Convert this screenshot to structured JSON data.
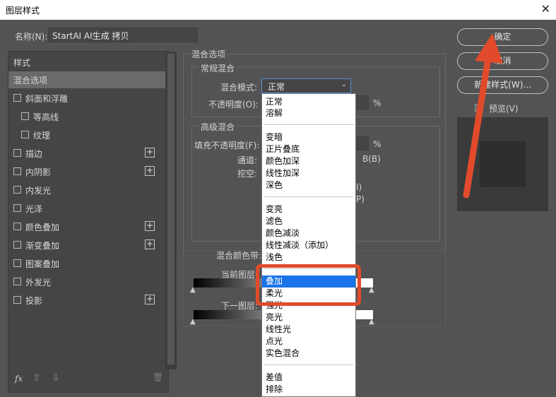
{
  "window": {
    "title": "图层样式",
    "close_glyph": "✕"
  },
  "name_row": {
    "label": "名称(N):",
    "value": "StartAI AI生成 拷贝"
  },
  "left_panel": {
    "header": "样式",
    "items": [
      {
        "label": "混合选项",
        "checkbox": false,
        "plus": false,
        "selected": true
      },
      {
        "label": "斜面和浮雕",
        "checkbox": true,
        "plus": false
      },
      {
        "label": "等高线",
        "checkbox": true,
        "plus": false,
        "indent": true
      },
      {
        "label": "纹理",
        "checkbox": true,
        "plus": false,
        "indent": true
      },
      {
        "label": "描边",
        "checkbox": true,
        "plus": true
      },
      {
        "label": "内阴影",
        "checkbox": true,
        "plus": true
      },
      {
        "label": "内发光",
        "checkbox": true,
        "plus": false
      },
      {
        "label": "光泽",
        "checkbox": true,
        "plus": false
      },
      {
        "label": "颜色叠加",
        "checkbox": true,
        "plus": true
      },
      {
        "label": "渐变叠加",
        "checkbox": true,
        "plus": true
      },
      {
        "label": "图案叠加",
        "checkbox": true,
        "plus": false
      },
      {
        "label": "外发光",
        "checkbox": true,
        "plus": false
      },
      {
        "label": "投影",
        "checkbox": true,
        "plus": true
      }
    ],
    "plus_glyph": "+",
    "bottom": {
      "fx": "fx",
      "up": "⇧",
      "down": "⇩",
      "trash": "🗑"
    }
  },
  "blend": {
    "section_title": "混合选项",
    "general_title": "常规混合",
    "mode_label": "混合模式:",
    "mode_value": "正常",
    "chevron": "⌄",
    "opacity_label": "不透明度(O):",
    "opacity_unit": "%",
    "advanced_title": "高级混合",
    "fill_label": "填充不透明度(F):",
    "fill_unit": "%",
    "channel_label": "通道:",
    "channel_b": "B(B)",
    "knockout_label": "挖空:",
    "right_partial_1": "I)",
    "right_partial_2": "P)",
    "blendif_label": "混合颜色带:",
    "this_layer": "当前图层:",
    "under_layer": "下一图层:"
  },
  "menu": {
    "items": [
      {
        "label": "正常",
        "y": 0
      },
      {
        "label": "溶解",
        "y": 1
      },
      {
        "label": "变暗",
        "y": 2
      },
      {
        "label": "正片叠底",
        "y": 3
      },
      {
        "label": "颜色加深",
        "y": 4
      },
      {
        "label": "线性加深",
        "y": 5
      },
      {
        "label": "深色",
        "y": 6
      },
      {
        "label": "变亮",
        "y": 7
      },
      {
        "label": "滤色",
        "y": 8
      },
      {
        "label": "颜色减淡",
        "y": 9
      },
      {
        "label": "线性减淡（添加）",
        "y": 10
      },
      {
        "label": "浅色",
        "y": 11
      },
      {
        "label": "叠加",
        "y": 12,
        "selected": true
      },
      {
        "label": "柔光",
        "y": 13
      },
      {
        "label": "强光",
        "y": 14
      },
      {
        "label": "亮光",
        "y": 15
      },
      {
        "label": "线性光",
        "y": 16
      },
      {
        "label": "点光",
        "y": 17
      },
      {
        "label": "实色混合",
        "y": 18
      },
      {
        "label": "差值",
        "y": 19
      },
      {
        "label": "排除",
        "y": 20
      }
    ]
  },
  "buttons": {
    "ok": "确定",
    "cancel": "取消",
    "new_style": "新建样式(W)...",
    "preview": "预览(V)"
  },
  "colors": {
    "accent": "#1a73e8",
    "annotation": "#e14b2c"
  }
}
